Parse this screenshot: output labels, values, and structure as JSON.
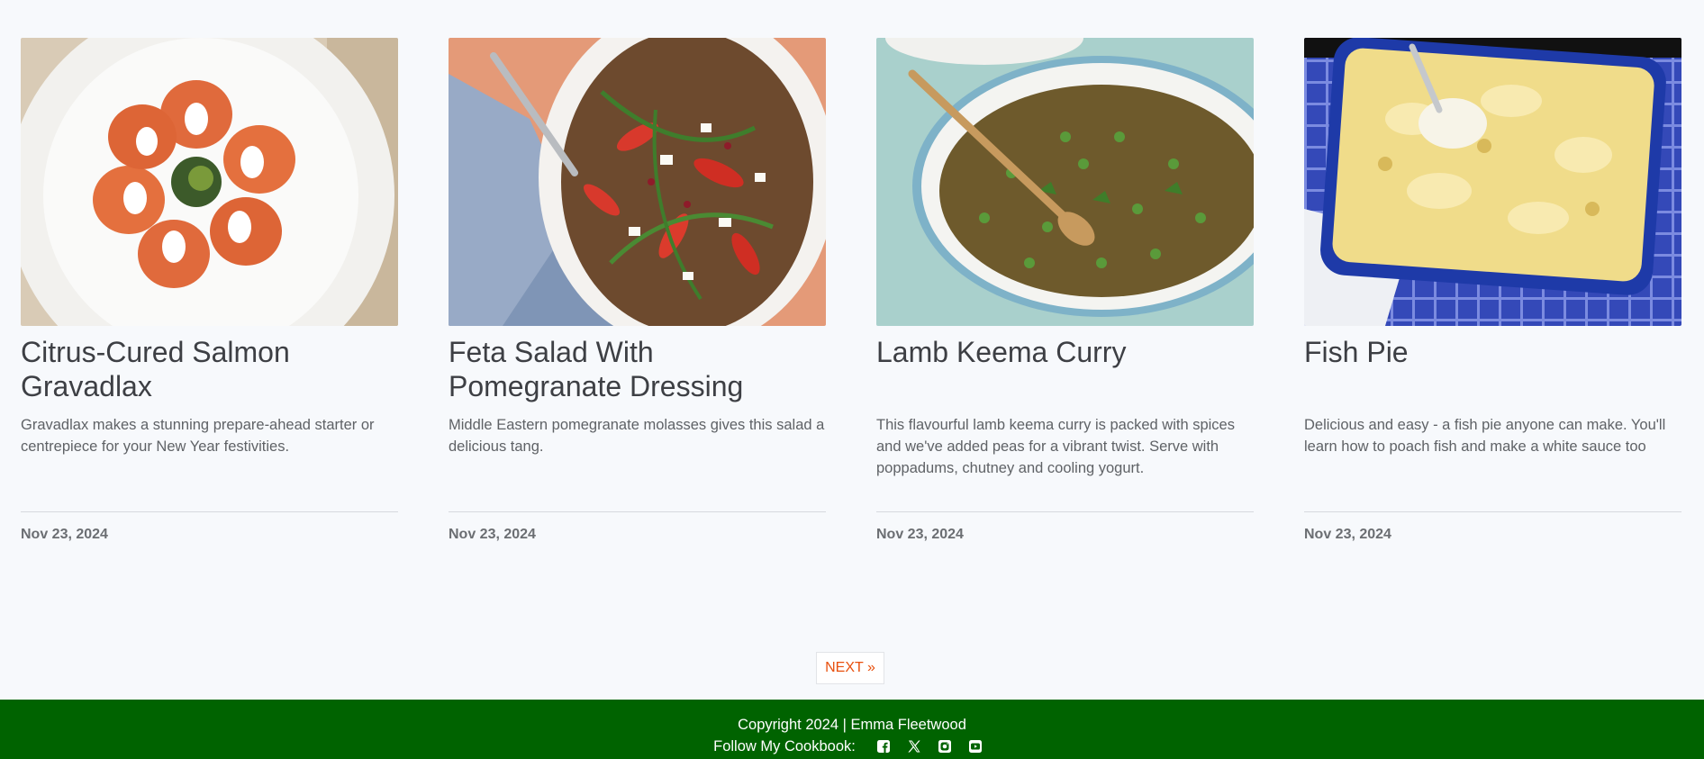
{
  "cards": [
    {
      "title": "Citrus-Cured Salmon Gravadlax",
      "excerpt": "Gravadlax makes a stunning prepare-ahead starter or centrepiece for your New Year festivities.",
      "date": "Nov 23, 2024",
      "image_alt": "Plate of citrus-cured salmon gravadlax"
    },
    {
      "title": "Feta Salad With Pomegranate Dressing",
      "excerpt": "Middle Eastern pomegranate molasses gives this salad a delicious tang.",
      "date": "Nov 23, 2024",
      "image_alt": "Feta salad with pomegranate dressing on an oval platter"
    },
    {
      "title": "Lamb Keema Curry",
      "excerpt": "This flavourful lamb keema curry is packed with spices and we've added peas for a vibrant twist. Serve with poppadums, chutney and cooling yogurt.",
      "date": "Nov 23, 2024",
      "image_alt": "Lamb keema curry with peas in a white pan"
    },
    {
      "title": "Fish Pie",
      "excerpt": "Delicious and easy - a fish pie anyone can make. You'll learn how to poach fish and make a white sauce too",
      "date": "Nov 23, 2024",
      "image_alt": "Fish pie in a blue baking dish"
    }
  ],
  "pagination": {
    "next_label": "NEXT »"
  },
  "footer": {
    "copyright": "Copyright 2024 | Emma Fleetwood",
    "follow_label": "Follow My Cookbook:",
    "social_icons": [
      "facebook-icon",
      "x-icon",
      "instagram-icon",
      "youtube-icon"
    ]
  },
  "colors": {
    "page_background": "#f7f9fc",
    "footer_background": "#006300",
    "accent": "#e8500e",
    "title": "#3d3f44"
  }
}
